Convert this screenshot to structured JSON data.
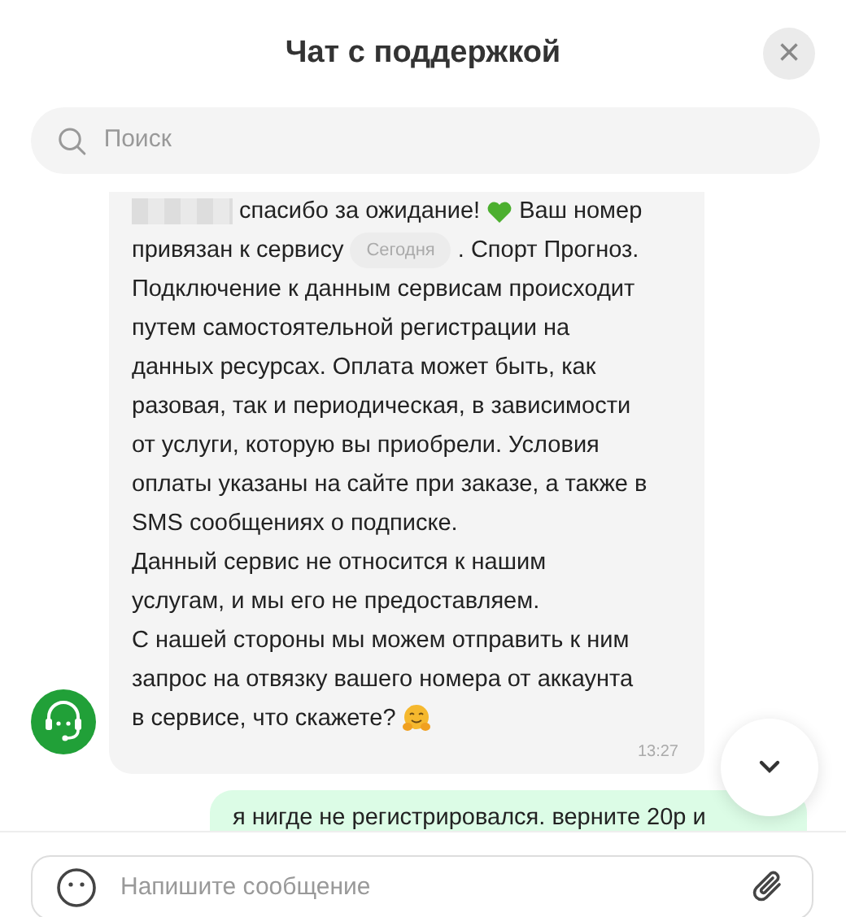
{
  "header": {
    "title": "Чат с поддержкой",
    "close": "×"
  },
  "search": {
    "placeholder": "Поиск"
  },
  "messages": [
    {
      "kind": "incoming",
      "time": "13:27",
      "lines": [
        [
          {
            "kind": "redacted"
          },
          {
            "kind": "text",
            "text": "спасибо за ожидание!"
          },
          {
            "kind": "heart"
          },
          {
            "kind": "text",
            "text": "Ваш номер"
          }
        ],
        [
          {
            "kind": "text",
            "text": "привязан к сервису"
          },
          {
            "kind": "badge",
            "text": "Сегодня"
          },
          {
            "kind": "text",
            "text": ". Спорт Прогноз."
          }
        ],
        [
          {
            "kind": "text",
            "text": "Подключение к данным сервисам происходит"
          }
        ],
        [
          {
            "kind": "text",
            "text": "путем самостоятельной регистрации на"
          }
        ],
        [
          {
            "kind": "text",
            "text": "данных ресурсах. Оплата может быть, как"
          }
        ],
        [
          {
            "kind": "text",
            "text": "разовая, так и периодическая, в зависимости"
          }
        ],
        [
          {
            "kind": "text",
            "text": "от услуги, которую вы приобрели. Условия"
          }
        ],
        [
          {
            "kind": "text",
            "text": "оплаты указаны на сайте при заказе, а также в"
          }
        ],
        [
          {
            "kind": "text",
            "text": "SMS сообщениях о подписке."
          }
        ],
        [
          {
            "kind": "text",
            "text": "Данный сервис не относится к нашим"
          }
        ],
        [
          {
            "kind": "text",
            "text": "услугам, и мы его не предоставляем."
          }
        ],
        [
          {
            "kind": "text",
            "text": "С нашей стороны мы можем отправить к ним"
          }
        ],
        [
          {
            "kind": "text",
            "text": "запрос на отвязку вашего номера от аккаунта"
          }
        ],
        [
          {
            "kind": "text",
            "text": "в сервисе, что скажете?"
          },
          {
            "kind": "hug"
          }
        ]
      ]
    },
    {
      "kind": "outgoing",
      "lines": [
        [
          {
            "kind": "text",
            "text": "я нигде не регистрировался. верните 20р и"
          }
        ]
      ]
    }
  ],
  "composer": {
    "placeholder": "Напишите сообщение"
  }
}
